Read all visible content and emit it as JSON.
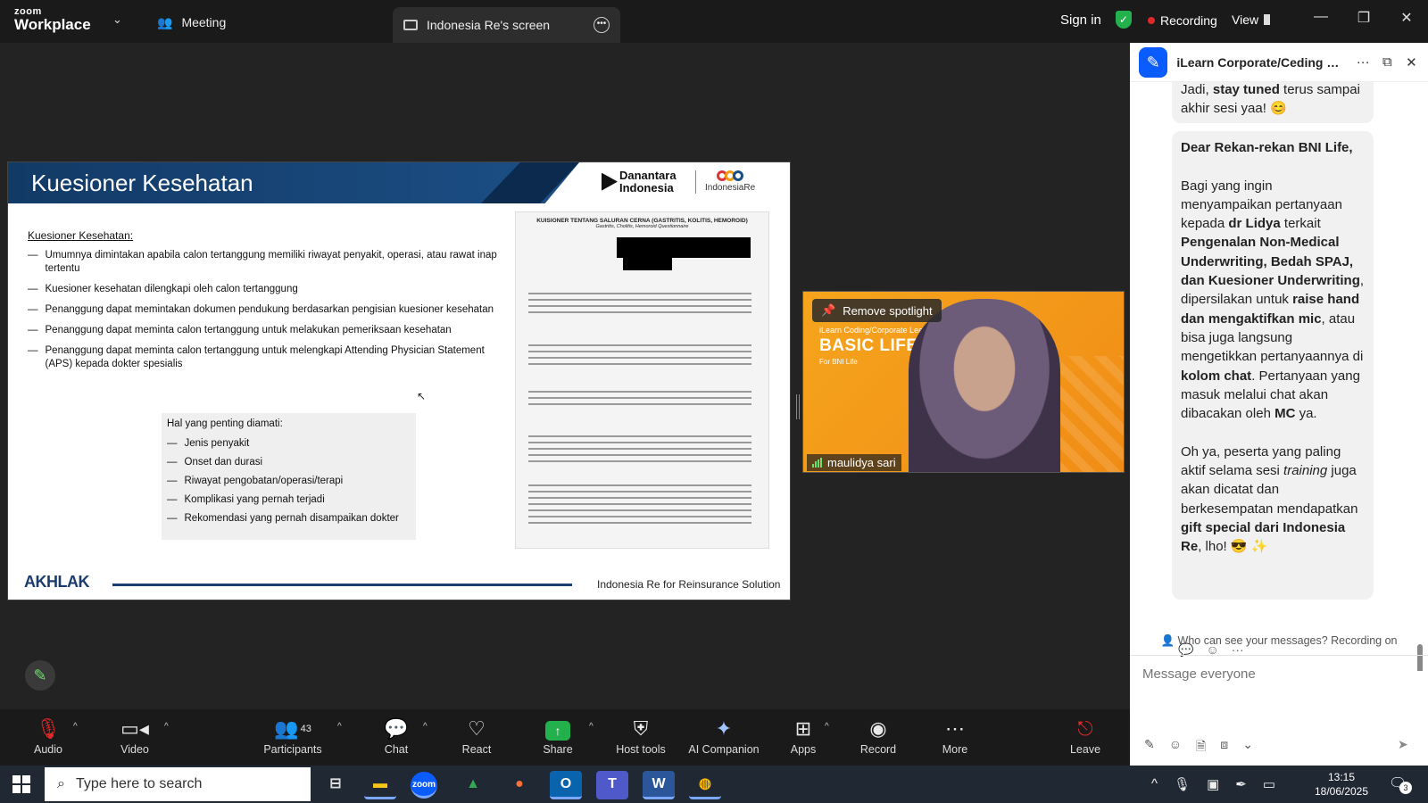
{
  "app": {
    "logo_top": "zoom",
    "logo_bottom": "Workplace",
    "meeting_tab": "Meeting",
    "screen_tab": "Indonesia Re's screen",
    "sign_in": "Sign in",
    "recording": "Recording",
    "view": "View",
    "colors": {
      "recording_dot": "#e02828",
      "secure_shield": "#22b14c",
      "accent": "#0b5cff"
    }
  },
  "slide": {
    "title": "Kuesioner Kesehatan",
    "logo_danantara": "Danantara Indonesia",
    "logo_indonesiare": "IndonesiaRe",
    "section_heading": "Kuesioner Kesehatan:",
    "bullets": [
      "Umumnya dimintakan apabila calon tertanggung memiliki riwayat penyakit, operasi, atau rawat inap tertentu",
      "Kuesioner kesehatan dilengkapi oleh calon tertanggung",
      "Penanggung dapat memintakan dokumen pendukung berdasarkan pengisian kuesioner kesehatan",
      "Penanggung dapat meminta calon tertanggung untuk melakukan pemeriksaan kesehatan",
      "Penanggung dapat meminta calon tertanggung untuk melengkapi Attending Physician Statement (APS) kepada dokter spesialis"
    ],
    "important_heading": "Hal yang penting diamati:",
    "important_items": [
      "Jenis penyakit",
      "Onset dan durasi",
      "Riwayat pengobatan/operasi/terapi",
      "Komplikasi yang pernah terjadi",
      "Rekomendasi yang pernah disampaikan dokter"
    ],
    "form_title": "KUISIONER TENTANG SALURAN CERNA (GASTRITIS, KOLITIS, HEMOROID)",
    "form_subtitle": "Gastritis, Cholitis, Hemoroid Questionnaire",
    "footer_logo": "AKHLAK",
    "footer_text": "Indonesia Re for Reinsurance Solution"
  },
  "video": {
    "spotlight_button": "Remove spotlight",
    "participant_name": "maulidya sari",
    "background_small": "iLearn Coding/Corporate Lea",
    "background_big": "BASIC LIFE AN        NING",
    "background_sub": "For BNI Life"
  },
  "chat": {
    "title": "iLearn Corporate/Ceding Le...",
    "privacy_note": "Who can see your messages? Recording on",
    "input_placeholder": "Message everyone",
    "msg1_parts": [
      "Jadi, ",
      "stay tuned",
      " terus sampai akhir sesi yaa! 😊"
    ],
    "msg2": {
      "greeting": "Dear Rekan-rekan BNI Life,",
      "p1_a": "Bagi yang ingin menyampaikan pertanyaan kepada ",
      "p1_b": "dr Lidya",
      "p1_c": " terkait ",
      "p1_d": "Pengenalan Non-Medical Underwriting, Bedah SPAJ, dan Kuesioner Underwriting",
      "p1_e": ", dipersilakan untuk ",
      "p1_f": "raise hand dan mengaktifkan mic",
      "p1_g": ", atau bisa juga langsung mengetikkan pertanyaannya di ",
      "p1_h": "kolom chat",
      "p1_i": ". Pertanyaan yang masuk melalui chat akan dibacakan oleh ",
      "p1_j": "MC",
      "p1_k": " ya.",
      "p2_a": "Oh ya, peserta yang paling aktif selama sesi ",
      "p2_b": "training",
      "p2_c": " juga akan dicatat dan berkesempatan mendapatkan ",
      "p2_d": "gift special dari Indonesia Re",
      "p2_e": ", lho! 😎 ✨"
    }
  },
  "toolbar": {
    "audio": "Audio",
    "video": "Video",
    "participants": "Participants",
    "participants_count": "43",
    "chat": "Chat",
    "react": "React",
    "share": "Share",
    "host_tools": "Host tools",
    "ai_companion": "AI Companion",
    "apps": "Apps",
    "record": "Record",
    "more": "More",
    "leave": "Leave"
  },
  "taskbar": {
    "search_placeholder": "Type here to search",
    "time": "13:15",
    "date": "18/06/2025",
    "notification_count": "3"
  }
}
